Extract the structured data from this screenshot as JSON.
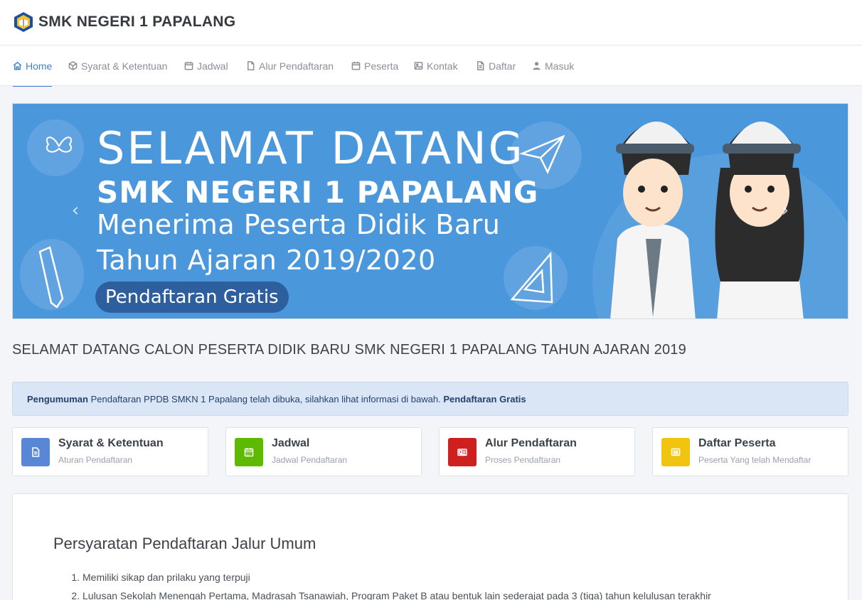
{
  "brand": {
    "name": "SMK NEGERI 1 PAPALANG"
  },
  "nav": {
    "items": [
      {
        "label": "Home",
        "icon": "home-icon",
        "active": true
      },
      {
        "label": "Syarat & Ketentuan",
        "icon": "box-icon"
      },
      {
        "label": "Jadwal",
        "icon": "calendar-icon"
      },
      {
        "label": "Alur Pendaftaran",
        "icon": "file-icon"
      },
      {
        "label": "Peserta",
        "icon": "calendar-icon"
      },
      {
        "label": "Kontak",
        "icon": "image-icon"
      },
      {
        "label": "Daftar",
        "icon": "file-text-icon"
      },
      {
        "label": "Masuk",
        "icon": "user-icon"
      }
    ]
  },
  "banner": {
    "line1": "SELAMAT  DATANG",
    "line2": "SMK NEGERI 1 PAPALANG",
    "line3": "Menerima Peserta Didik Baru",
    "line4": "Tahun Ajaran 2019/2020",
    "badge": "Pendaftaran Gratis",
    "prev": "‹",
    "next": "›",
    "color": "#4a97dc"
  },
  "page_title": "SELAMAT DATANG CALON PESERTA DIDIK BARU SMK NEGERI 1 PAPALANG TAHUN AJARAN 2019",
  "announcement": {
    "label": "Pengumuman",
    "text": " Pendaftaran PPDB SMKN 1 Papalang telah dibuka, silahkan lihat informasi di bawah. ",
    "highlight": "Pendaftaran Gratis"
  },
  "cards": [
    {
      "title": "Syarat & Ketentuan",
      "subtitle": "Aturan Pendaftaran",
      "color": "#5a86d6",
      "icon": "document-icon"
    },
    {
      "title": "Jadwal",
      "subtitle": "Jadwal Pendaftaran",
      "color": "#5eba00",
      "icon": "calendar-icon"
    },
    {
      "title": "Alur Pendaftaran",
      "subtitle": "Proses Pendaftaran",
      "color": "#cd201f",
      "icon": "id-card-icon"
    },
    {
      "title": "Daftar Peserta",
      "subtitle": "Peserta Yang telah Mendaftar",
      "color": "#f1c40f",
      "icon": "list-icon"
    }
  ],
  "content": {
    "heading": "Persyaratan Pendaftaran Jalur Umum",
    "items": [
      "Memiliki sikap dan prilaku yang terpuji",
      "Lulusan Sekolah Menengah Pertama, Madrasah Tsanawiah, Program Paket B atau bentuk lain sederajat pada 3 (tiga) tahun kelulusan terakhir"
    ]
  }
}
